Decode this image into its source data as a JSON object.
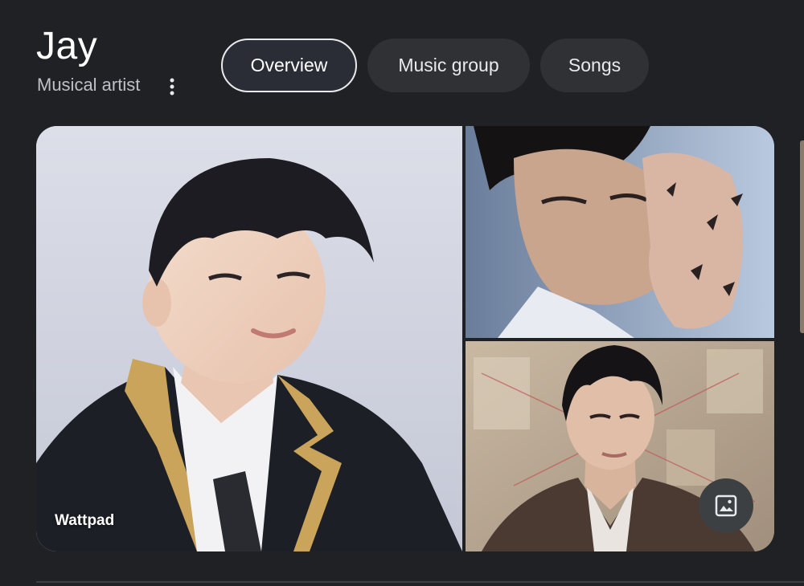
{
  "header": {
    "title": "Jay",
    "subtitle": "Musical artist"
  },
  "tabs": [
    {
      "label": "Overview",
      "active": true
    },
    {
      "label": "Music group",
      "active": false
    },
    {
      "label": "Songs",
      "active": false
    }
  ],
  "images": {
    "main_source": "Wattpad"
  },
  "icons": {
    "more": "more-vert-icon",
    "image_search": "image-icon"
  },
  "colors": {
    "background": "#202124",
    "tab_background": "#303134",
    "tab_active_border": "#e8eaed",
    "text_primary": "#ffffff",
    "text_secondary": "#bdc1c6"
  }
}
